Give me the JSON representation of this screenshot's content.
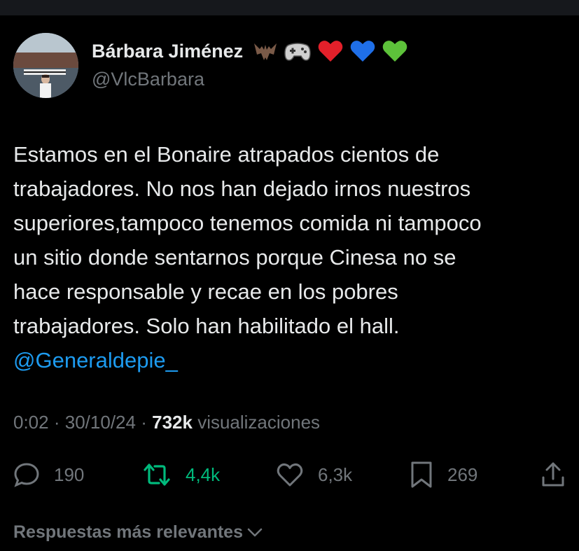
{
  "author": {
    "display_name": "Bárbara Jiménez",
    "handle": "@VlcBarbara",
    "name_emojis": [
      "bat-icon",
      "game-controller-icon",
      "red-heart-icon",
      "blue-heart-icon",
      "green-heart-icon"
    ]
  },
  "tweet": {
    "lines": [
      "Estamos en el Bonaire atrapados cientos de",
      "trabajadores. No nos han dejado irnos nuestros",
      "superiores,tampoco tenemos comida ni tampoco",
      "un sitio donde sentarnos porque Cinesa no se",
      "hace responsable y recae en los pobres",
      "trabajadores. Solo han habilitado el hall."
    ],
    "mention": "@Generaldepie_"
  },
  "meta": {
    "time": "0:02",
    "date": "30/10/24",
    "separator": "·",
    "views_count": "732k",
    "views_label": "visualizaciones"
  },
  "actions": {
    "replies": "190",
    "retweets": "4,4k",
    "likes": "6,3k",
    "bookmarks": "269"
  },
  "replies_sort": {
    "label": "Respuestas más relevantes"
  },
  "colors": {
    "background": "#000000",
    "text_primary": "#e7e9ea",
    "text_secondary": "#71767b",
    "link": "#1d9bf0",
    "retweet": "#00ba7c"
  }
}
